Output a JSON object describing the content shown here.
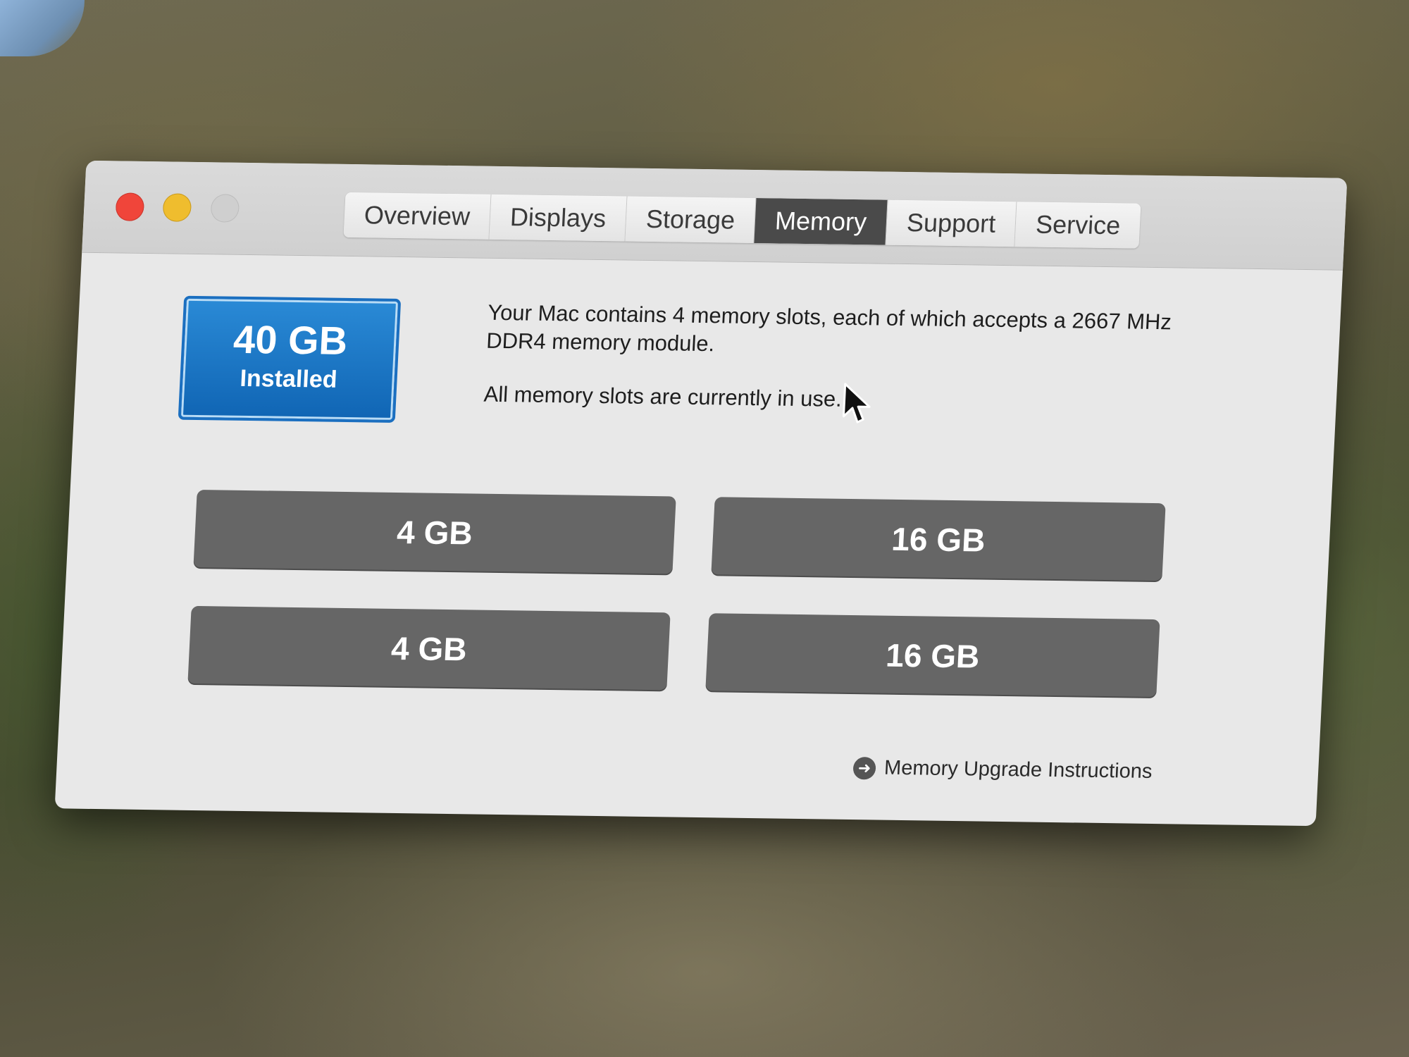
{
  "tabs": [
    {
      "label": "Overview"
    },
    {
      "label": "Displays"
    },
    {
      "label": "Storage"
    },
    {
      "label": "Memory"
    },
    {
      "label": "Support"
    },
    {
      "label": "Service"
    }
  ],
  "active_tab": "Memory",
  "badge": {
    "size": "40 GB",
    "label": "Installed"
  },
  "description": {
    "line1": "Your Mac contains 4 memory slots, each of which accepts a 2667 MHz DDR4 memory module.",
    "line2": "All memory slots are currently in use."
  },
  "slots": [
    {
      "value": "4 GB"
    },
    {
      "value": "16 GB"
    },
    {
      "value": "4 GB"
    },
    {
      "value": "16 GB"
    }
  ],
  "upgrade_link": {
    "label": "Memory Upgrade Instructions",
    "icon": "arrow-right-circle-icon"
  },
  "colors": {
    "close": "#f0453a",
    "minimize": "#efbd2e",
    "badge": "#1a75c6",
    "slot": "#666666",
    "active_tab": "#4a4a4a"
  }
}
